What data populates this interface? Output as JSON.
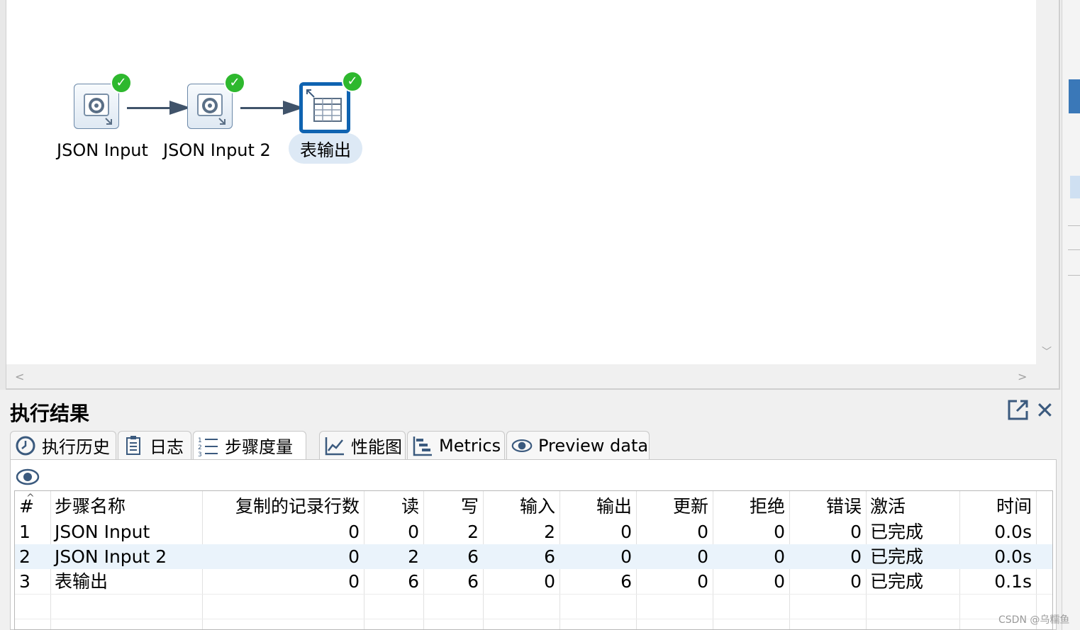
{
  "canvas": {
    "steps": [
      {
        "label": "JSON Input",
        "status": "success-check"
      },
      {
        "label": "JSON Input 2",
        "status": "success-check"
      },
      {
        "label": "表输出",
        "status": "success-check"
      }
    ]
  },
  "panel": {
    "title": "执行结果",
    "tabs": [
      {
        "label": "执行历史",
        "icon": "history-clock-icon"
      },
      {
        "label": "日志",
        "icon": "log-document-icon"
      },
      {
        "label": "步骤度量",
        "icon": "step-metrics-list-icon"
      },
      {
        "label": "性能图",
        "icon": "performance-chart-icon"
      },
      {
        "label": "Metrics",
        "icon": "metrics-gantt-icon"
      },
      {
        "label": "Preview data",
        "icon": "eye-icon"
      }
    ],
    "active_tab": "步骤度量"
  },
  "table": {
    "headers": [
      "#",
      "步骤名称",
      "复制的记录行数",
      "读",
      "写",
      "输入",
      "输出",
      "更新",
      "拒绝",
      "错误",
      "激活",
      "时间"
    ],
    "rows": [
      [
        "1",
        "JSON Input",
        "0",
        "0",
        "2",
        "2",
        "0",
        "0",
        "0",
        "0",
        "已完成",
        "0.0s"
      ],
      [
        "2",
        "JSON Input 2",
        "0",
        "2",
        "6",
        "6",
        "0",
        "0",
        "0",
        "0",
        "已完成",
        "0.0s"
      ],
      [
        "3",
        "表输出",
        "0",
        "6",
        "6",
        "0",
        "6",
        "0",
        "0",
        "0",
        "已完成",
        "0.1s"
      ]
    ]
  },
  "colors": {
    "accent": "#0f63b1",
    "success": "#2eb82e",
    "hop": "#40536a",
    "row_highlight": "#eaf3fb"
  },
  "watermark": "CSDN @乌糯鱼"
}
